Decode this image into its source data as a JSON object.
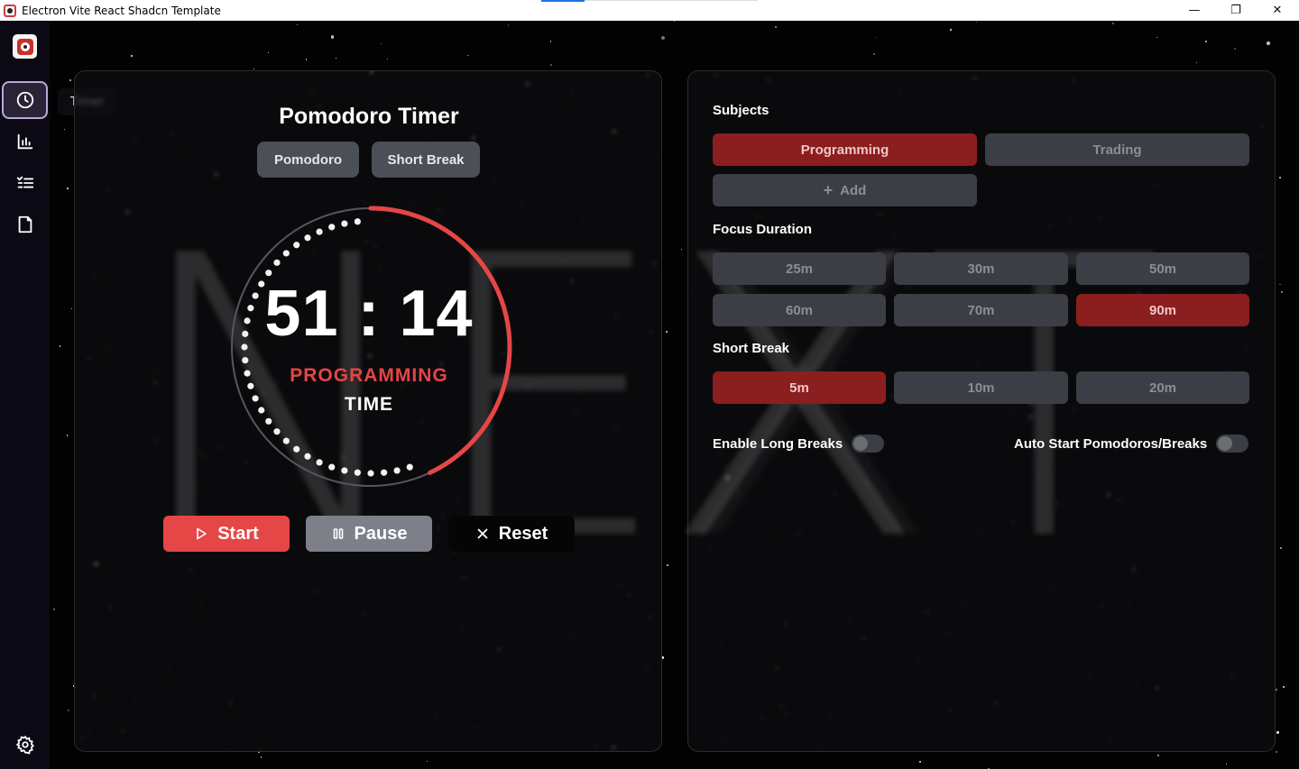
{
  "window": {
    "title": "Electron Vite React Shadcn Template",
    "minimize": "—",
    "maximize": "❐",
    "close": "✕"
  },
  "sidebar": {
    "tooltip": "Timer",
    "items": [
      {
        "name": "timer",
        "icon": "clock-icon"
      },
      {
        "name": "stats",
        "icon": "bar-chart-icon"
      },
      {
        "name": "tasks",
        "icon": "checklist-icon"
      },
      {
        "name": "notes",
        "icon": "file-icon"
      }
    ],
    "settings_icon": "gear-icon"
  },
  "timer": {
    "title": "Pomodoro Timer",
    "modes": [
      "Pomodoro",
      "Short Break"
    ],
    "time": "51:14",
    "subject": "PROGRAMMING",
    "label": "TIME",
    "progress": 0.43,
    "accent": "#e54646",
    "actions": {
      "start": "Start",
      "pause": "Pause",
      "reset": "Reset"
    }
  },
  "settings": {
    "subjects_label": "Subjects",
    "subjects": [
      "Programming",
      "Trading"
    ],
    "selected_subject": "Programming",
    "add_label": "Add",
    "focus_label": "Focus Duration",
    "focus_options": [
      "25m",
      "30m",
      "50m",
      "60m",
      "70m",
      "90m"
    ],
    "selected_focus": "90m",
    "short_break_label": "Short Break",
    "short_break_options": [
      "5m",
      "10m",
      "20m"
    ],
    "selected_short_break": "5m",
    "long_breaks_label": "Enable Long Breaks",
    "long_breaks_enabled": false,
    "auto_start_label": "Auto Start Pomodoros/Breaks",
    "auto_start_enabled": false
  },
  "colors": {
    "selected": "#8b1e1e",
    "unselected": "#3b3e44",
    "sidebar_active_border": "#b8a9d9"
  }
}
